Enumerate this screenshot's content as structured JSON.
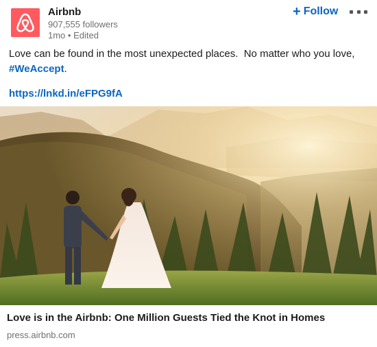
{
  "author": {
    "name": "Airbnb",
    "followers": "907,555 followers",
    "meta": "1mo • Edited",
    "logo_color": "#ff5a5f"
  },
  "actions": {
    "follow_label": "Follow",
    "follow_icon": "plus-icon",
    "more_icon": "more-dots-icon",
    "accent_color": "#0a66c2"
  },
  "post": {
    "text_line1": "Love can be found in the most unexpected places.  No matter who you love,",
    "hashtag": "#WeAccept",
    "hashtag_suffix": ".",
    "link": "https://lnkd.in/eFPG9fA"
  },
  "card": {
    "image": "wedding-couple-on-misty-hillside-photo",
    "title": "Love is in the Airbnb: One Million Guests Tied the Knot in Homes",
    "source": "press.airbnb.com"
  }
}
